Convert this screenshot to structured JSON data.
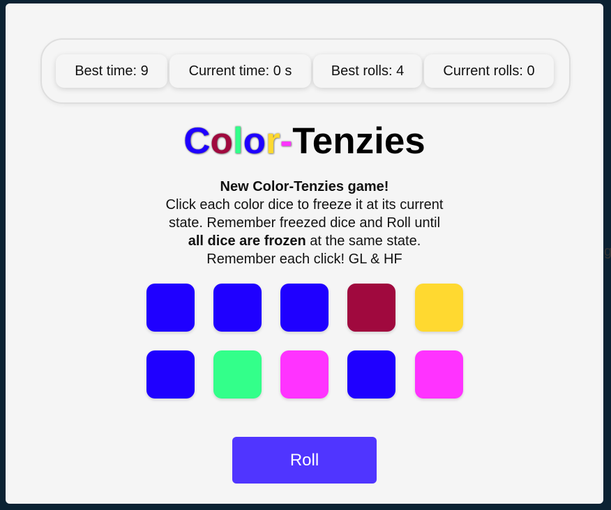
{
  "stats": {
    "best_time": "Best time: 9",
    "current_time": "Current time: 0 s",
    "best_rolls": "Best rolls: 4",
    "current_rolls": "Current rolls: 0"
  },
  "title": {
    "letters": [
      {
        "char": "C",
        "color": "#1f00ff"
      },
      {
        "char": "o",
        "color": "#a0093e"
      },
      {
        "char": "l",
        "color": "#33ff8a"
      },
      {
        "char": "o",
        "color": "#1f00ff"
      },
      {
        "char": "r",
        "color": "#ffd930"
      },
      {
        "char": "-",
        "color": "#ff33ff"
      }
    ],
    "rest": "Tenzies"
  },
  "description": {
    "heading": "New Color-Tenzies game!",
    "line1": "Click each color dice to freeze it at its current",
    "line2": "state. Remember freezed dice and Roll until",
    "line3_bold": "all dice are frozen",
    "line3_rest": " at the same state.",
    "line4": "Remember each click! GL & HF"
  },
  "dice": [
    {
      "color": "#1f00ff"
    },
    {
      "color": "#1f00ff"
    },
    {
      "color": "#1f00ff"
    },
    {
      "color": "#a0093e"
    },
    {
      "color": "#ffd930"
    },
    {
      "color": "#1f00ff"
    },
    {
      "color": "#33ff8a"
    },
    {
      "color": "#ff33ff"
    },
    {
      "color": "#1f00ff"
    },
    {
      "color": "#ff33ff"
    }
  ],
  "roll_button": "Roll",
  "stray_text": "g"
}
